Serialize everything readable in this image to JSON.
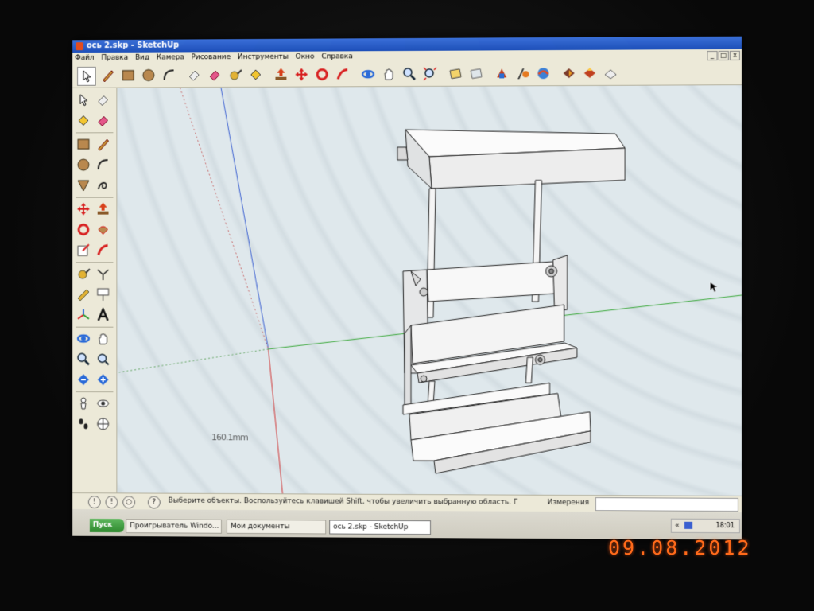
{
  "window": {
    "title": "ось 2.skp - SketchUp",
    "controls": [
      "_",
      "□",
      "x"
    ]
  },
  "menu": [
    "Файл",
    "Правка",
    "Вид",
    "Камера",
    "Рисование",
    "Инструменты",
    "Окно",
    "Справка"
  ],
  "toolbar_icons": [
    "select-arrow",
    "pencil",
    "rectangle",
    "circle",
    "arc",
    "eraser",
    "eraser2",
    "tape-measure",
    "paint-bucket",
    "push-pull",
    "move",
    "rotate",
    "follow-me",
    "orbit",
    "pan",
    "zoom",
    "zoom-extents",
    "previous",
    "next",
    "components",
    "section",
    "3d-warehouse",
    "get-models",
    "share-model",
    "preferences"
  ],
  "left_toolbar_icons": [
    "select",
    "make-component",
    "paint-bucket",
    "eraser",
    "rectangle",
    "line",
    "circle",
    "arc",
    "polygon",
    "freehand",
    "move",
    "push-pull",
    "rotate",
    "follow-me",
    "scale",
    "offset",
    "tape-measure",
    "dimension",
    "protractor",
    "text",
    "axes",
    "3d-text",
    "orbit",
    "pan",
    "zoom",
    "zoom-window",
    "previous",
    "zoom-extents",
    "position-camera",
    "look-around",
    "walk",
    "section-plane"
  ],
  "viewport": {
    "dimension_label": "160.1mm"
  },
  "status": {
    "hint": "Выберите объекты. Воспользуйтесь клавишей Shift, чтобы увеличить выбранную область. Г",
    "measurements_label": "Измерения",
    "measurements_value": ""
  },
  "taskbar": {
    "start_label": "Пуск",
    "tasks": [
      "Проигрыватель Windo...",
      "Мои документы",
      "ось 2.skp - SketchUp"
    ],
    "tray_chevron": "«",
    "clock": "18:01"
  },
  "photo_date_stamp": "09.08.2012",
  "colors": {
    "title_bar": "#1d4fb8",
    "viewport_bg": "#dfe8ec",
    "axis_blue": "#3a5fd0",
    "axis_red": "#d03a3a",
    "axis_green": "#3aa83a",
    "date_stamp": "#ff6a1a"
  }
}
